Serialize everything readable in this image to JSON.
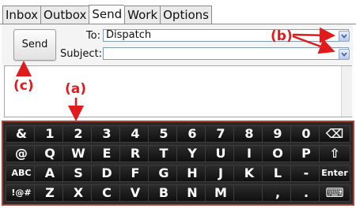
{
  "tabs": [
    "Inbox",
    "Outbox",
    "Send",
    "Work",
    "Options"
  ],
  "active_tab": "Send",
  "compose": {
    "send_label": "Send",
    "to_label": "To:",
    "to_value": "Dispatch",
    "subject_label": "Subject:",
    "subject_value": ""
  },
  "annotations": {
    "a": "(a)",
    "b": "(b)",
    "c": "(c)"
  },
  "keyboard": {
    "rows": [
      [
        "&",
        "1",
        "2",
        "3",
        "4",
        "5",
        "6",
        "7",
        "8",
        "9",
        "0",
        "⌫"
      ],
      [
        "@",
        "Q",
        "W",
        "E",
        "R",
        "T",
        "Y",
        "U",
        "I",
        "O",
        "P",
        "⇧"
      ],
      [
        "ABC",
        "A",
        "S",
        "D",
        "F",
        "G",
        "H",
        "J",
        "K",
        "L",
        "-",
        "Enter"
      ],
      [
        "!@#",
        "Z",
        "X",
        "C",
        "V",
        "B",
        "N",
        "M",
        "",
        ",",
        ".",
        "⌨"
      ]
    ]
  },
  "colors": {
    "annotation": "#e01b1b",
    "keyboard_bg": "#2a2a2a",
    "keyboard_border": "#a6423a"
  }
}
